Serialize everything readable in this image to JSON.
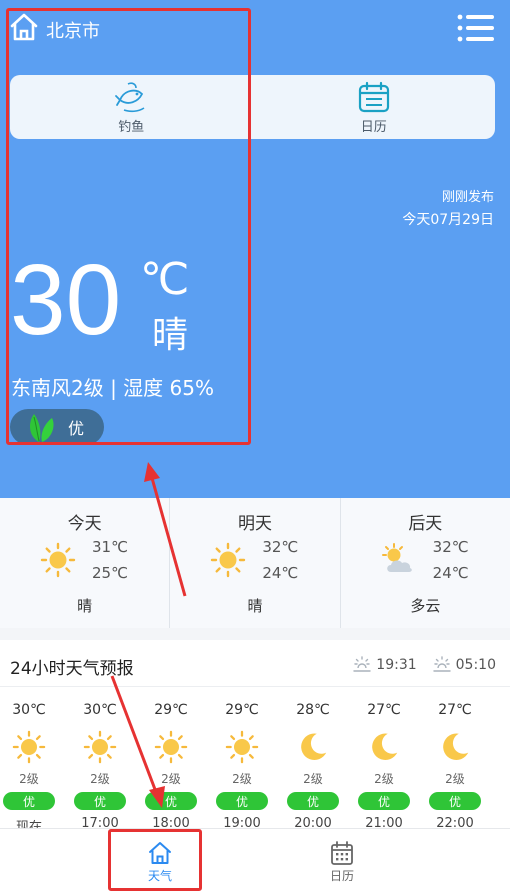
{
  "header": {
    "city": "北京市",
    "home_icon": "home-icon",
    "menu_icon": "menu-icon"
  },
  "shortcuts": [
    {
      "label": "钓鱼",
      "icon": "fish-icon"
    },
    {
      "label": "日历",
      "icon": "calendar-icon"
    }
  ],
  "current": {
    "publish_status": "刚刚发布",
    "date": "今天07月29日",
    "temperature": "30",
    "unit": "℃",
    "condition": "晴",
    "wind_humidity": "东南风2级 | 湿度 65%",
    "aqi": "优",
    "aqi_icon": "leaf-icon"
  },
  "daily": [
    {
      "day": "今天",
      "high": "31℃",
      "low": "25℃",
      "condition": "晴",
      "icon": "sun-icon"
    },
    {
      "day": "明天",
      "high": "32℃",
      "low": "24℃",
      "condition": "晴",
      "icon": "sun-icon"
    },
    {
      "day": "后天",
      "high": "32℃",
      "low": "24℃",
      "condition": "多云",
      "icon": "partly-cloudy-icon"
    }
  ],
  "hourly": {
    "title": "24小时天气预报",
    "sunrise": "19:31",
    "sunset": "05:10",
    "items": [
      {
        "temp": "30℃",
        "icon": "sun-icon",
        "wind": "2级",
        "aqi": "优",
        "time": "现在"
      },
      {
        "temp": "30℃",
        "icon": "sun-icon",
        "wind": "2级",
        "aqi": "优",
        "time": "17:00"
      },
      {
        "temp": "29℃",
        "icon": "sun-icon",
        "wind": "2级",
        "aqi": "优",
        "time": "18:00"
      },
      {
        "temp": "29℃",
        "icon": "sun-icon",
        "wind": "2级",
        "aqi": "优",
        "time": "19:00"
      },
      {
        "temp": "28℃",
        "icon": "moon-icon",
        "wind": "2级",
        "aqi": "优",
        "time": "20:00"
      },
      {
        "temp": "27℃",
        "icon": "moon-icon",
        "wind": "2级",
        "aqi": "优",
        "time": "21:00"
      },
      {
        "temp": "27℃",
        "icon": "moon-icon",
        "wind": "2级",
        "aqi": "优",
        "time": "22:00"
      }
    ]
  },
  "bottom_nav": [
    {
      "label": "天气",
      "icon": "home-icon",
      "active": true
    },
    {
      "label": "日历",
      "icon": "calendar-icon",
      "active": false
    }
  ],
  "colors": {
    "hero_blue": "#5b9ff2",
    "active_blue": "#2b8af0",
    "aqi_green": "#2fc537",
    "sun_orange": "#f6b93b",
    "annotation_red": "#e63232"
  }
}
